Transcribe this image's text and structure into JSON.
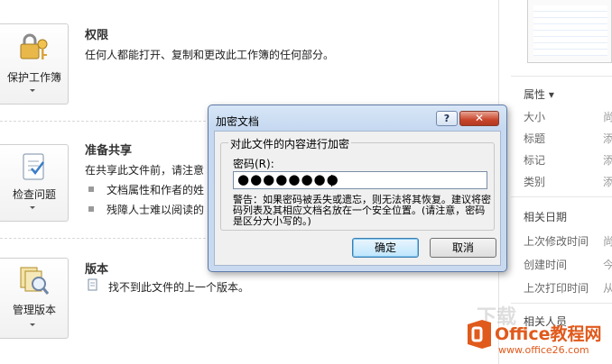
{
  "sections": {
    "permissions": {
      "button_label": "保护工作簿",
      "heading": "权限",
      "text": "任何人都能打开、复制和更改此工作簿的任何部分。"
    },
    "share": {
      "button_label": "检查问题",
      "heading": "准备共享",
      "text": "在共享此文件前，请注意",
      "bullets": [
        "文档属性和作者的姓",
        "残障人士难以阅读的"
      ]
    },
    "versions": {
      "button_label": "管理版本",
      "heading": "版本",
      "text": "找不到此文件的上一个版本。"
    }
  },
  "right_panel": {
    "properties_heading": "属性 ▾",
    "properties": [
      {
        "label": "大小",
        "value": "尚"
      },
      {
        "label": "标题",
        "value": "添"
      },
      {
        "label": "标记",
        "value": "添"
      },
      {
        "label": "类别",
        "value": "添"
      }
    ],
    "dates_heading": "相关日期",
    "dates": [
      {
        "label": "上次修改时间",
        "value": "尚"
      },
      {
        "label": "创建时间",
        "value": "今"
      },
      {
        "label": "上次打印时间",
        "value": "从"
      }
    ],
    "people_heading": "相关人员"
  },
  "dialog": {
    "title": "加密文档",
    "help": "?",
    "close": "✕",
    "group_title": "对此文件的内容进行加密",
    "password_label": "密码(R):",
    "password_mask": "●●●●●●●●",
    "warning": "警告：如果密码被丢失或遗忘，则无法将其恢复。建议将密码列表及其相应文档名放在一个安全位置。(请注意，密码是区分大小写的。)",
    "ok": "确定",
    "cancel": "取消"
  },
  "watermark": {
    "brand": "Office教程网",
    "url": "www.office26.com",
    "faint": "下载"
  },
  "colors": {
    "accent_orange": "#e05a1c",
    "dialog_border": "#5d7aa6",
    "close_red": "#c8452b"
  }
}
